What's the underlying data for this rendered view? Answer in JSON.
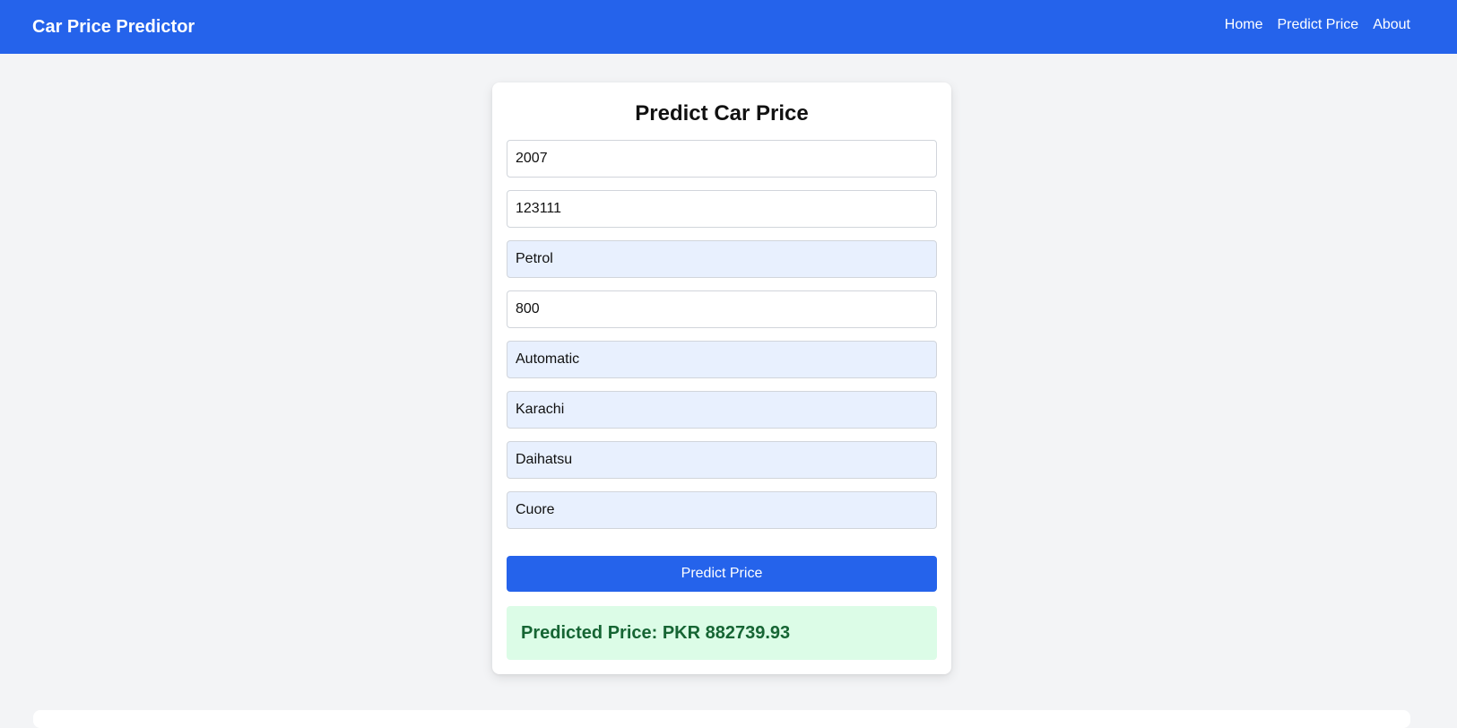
{
  "navbar": {
    "brand": "Car Price Predictor",
    "links": [
      "Home",
      "Predict Price",
      "About"
    ]
  },
  "form": {
    "title": "Predict Car Price",
    "fields": [
      {
        "name": "year",
        "value": "2007",
        "autofill": false
      },
      {
        "name": "mileage",
        "value": "123111",
        "autofill": false
      },
      {
        "name": "fuel-type",
        "value": "Petrol",
        "autofill": true
      },
      {
        "name": "engine-capacity",
        "value": "800",
        "autofill": false
      },
      {
        "name": "transmission",
        "value": "Automatic",
        "autofill": true
      },
      {
        "name": "city",
        "value": "Karachi",
        "autofill": true
      },
      {
        "name": "make",
        "value": "Daihatsu",
        "autofill": true
      },
      {
        "name": "model",
        "value": "Cuore",
        "autofill": true
      }
    ],
    "submit_label": "Predict Price",
    "result": "Predicted Price: PKR 882739.93"
  },
  "colors": {
    "primary": "#2563eb",
    "background": "#f3f4f6",
    "autofill": "#e8f0fe",
    "result_bg": "#dcfce7",
    "result_text": "#166534"
  }
}
